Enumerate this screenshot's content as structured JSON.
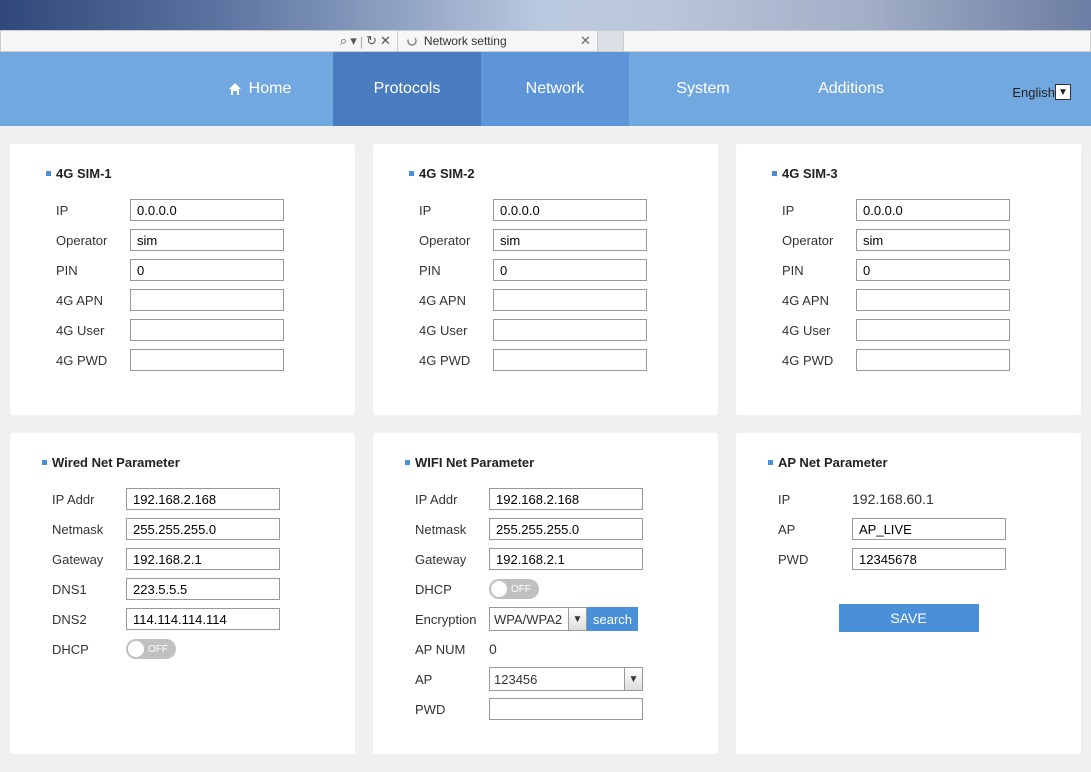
{
  "browser": {
    "tab_title": "Network setting",
    "search_glyph": "⌕",
    "dropdown_glyph": "▾",
    "refresh_glyph": "↻",
    "close_glyph": "✕"
  },
  "nav": {
    "home": "Home",
    "protocols": "Protocols",
    "network": "Network",
    "system": "System",
    "additions": "Additions",
    "language": "English",
    "lang_arrow": "▼"
  },
  "labels": {
    "ip": "IP",
    "operator": "Operator",
    "pin": "PIN",
    "apn": "4G APN",
    "user": "4G User",
    "pwd4g": "4G PWD",
    "ip_addr": "IP Addr",
    "netmask": "Netmask",
    "gateway": "Gateway",
    "dns1": "DNS1",
    "dns2": "DNS2",
    "dhcp": "DHCP",
    "encryption": "Encryption",
    "ap_num": "AP NUM",
    "ap": "AP",
    "pwd": "PWD",
    "off": "OFF",
    "search": "search",
    "save": "SAVE"
  },
  "sim1": {
    "title": "4G SIM-1",
    "ip": "0.0.0.0",
    "operator": "sim",
    "pin": "0",
    "apn": "",
    "user": "",
    "pwd": ""
  },
  "sim2": {
    "title": "4G SIM-2",
    "ip": "0.0.0.0",
    "operator": "sim",
    "pin": "0",
    "apn": "",
    "user": "",
    "pwd": ""
  },
  "sim3": {
    "title": "4G SIM-3",
    "ip": "0.0.0.0",
    "operator": "sim",
    "pin": "0",
    "apn": "",
    "user": "",
    "pwd": ""
  },
  "wired": {
    "title": "Wired Net Parameter",
    "ip_addr": "192.168.2.168",
    "netmask": "255.255.255.0",
    "gateway": "192.168.2.1",
    "dns1": "223.5.5.5",
    "dns2": "114.114.114.114"
  },
  "wifi": {
    "title": "WIFI Net Parameter",
    "ip_addr": "192.168.2.168",
    "netmask": "255.255.255.0",
    "gateway": "192.168.2.1",
    "encryption": "WPA/WPA2",
    "ap_num": "0",
    "ap": "123456",
    "pwd": ""
  },
  "apnet": {
    "title": "AP Net Parameter",
    "ip": "192.168.60.1",
    "ap": "AP_LIVE",
    "pwd": "12345678"
  }
}
